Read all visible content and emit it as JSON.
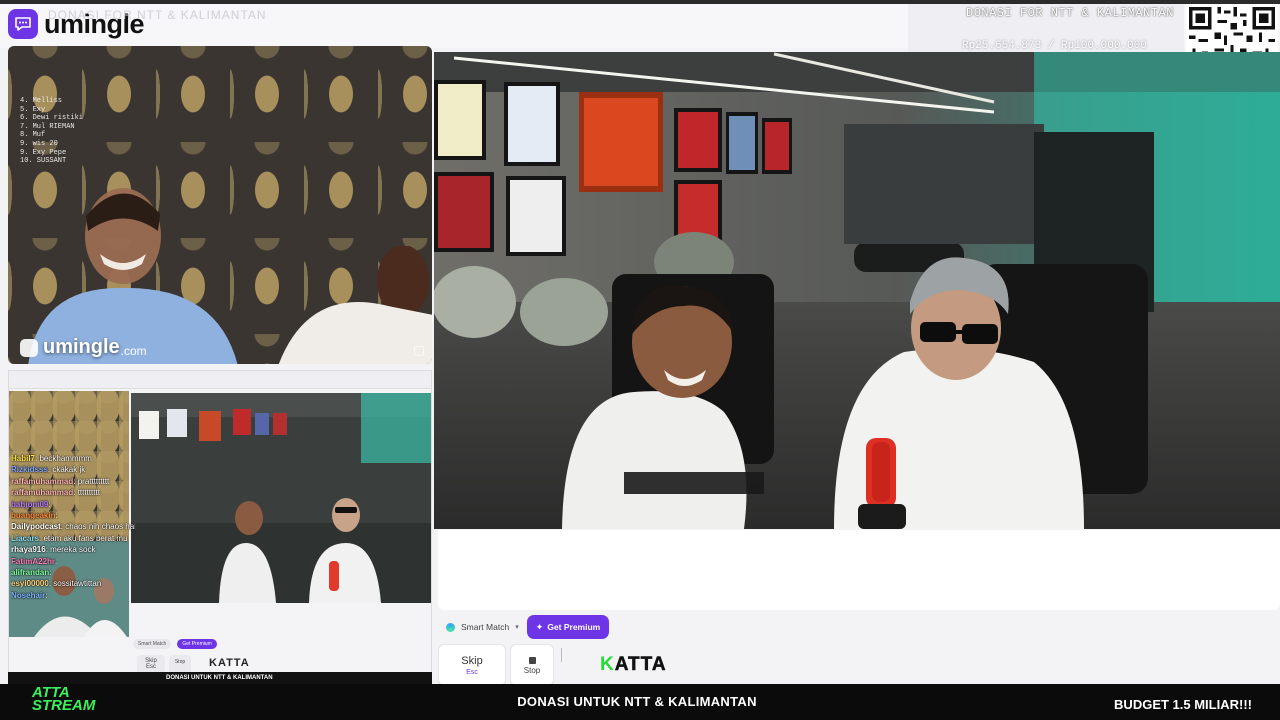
{
  "app": {
    "brand": "umingle",
    "watermark": "umingle",
    "watermark_suffix": ".com",
    "ghost_title": "DONASI FOR NTT & KALIMANTAN"
  },
  "donation": {
    "title": "DONASI FOR NTT & KALIMANTAN",
    "amount": "Rp25.654.873 / Rp100.000.000"
  },
  "leaderboard": [
    "4. Melliss",
    "5. Exy",
    "6. Dewi ristiki",
    "7. Mul RIEMAN",
    "8. Muf",
    "9. wis 20",
    "9. Exy Pepe",
    "10. SUSSANT"
  ],
  "chat": [
    {
      "user": "Habil7",
      "text": "beckhammmm",
      "color": "#ffe44d"
    },
    {
      "user": "Rizkidsss",
      "text": "ckakak jk",
      "color": "#7ea6ff"
    },
    {
      "user": "raffamuhammad",
      "text": "prattttttttt",
      "color": "#ffb3b3"
    },
    {
      "user": "raffamuhammad",
      "text": "tttttttttt",
      "color": "#ffb3b3"
    },
    {
      "user": "bahjoni09",
      "text": "",
      "color": "#b47bff"
    },
    {
      "user": "buangeakin",
      "text": "",
      "color": "#ff8a3d"
    },
    {
      "user": "Dailypodcast",
      "text": "chaos nih chaos haha",
      "color": "#ffffff"
    },
    {
      "user": "Liacars",
      "text": "etam aku fans berat mu",
      "color": "#7de3ff"
    },
    {
      "user": "rhaya916",
      "text": "mereka sock",
      "color": "#ffffff"
    },
    {
      "user": "FatimA22hr",
      "text": "",
      "color": "#ff7db8"
    },
    {
      "user": "alifrandan",
      "text": "",
      "color": "#7dff9a"
    },
    {
      "user": "esyi00000",
      "text": "sossitawtittan",
      "color": "#ffd27d"
    },
    {
      "user": "Nosehair",
      "text": "",
      "color": "#7db4ff"
    }
  ],
  "controls": {
    "smart_match": "Smart Match",
    "premium": "Get Premium",
    "skip": "Skip",
    "skip_hint": "Esc",
    "stop": "Stop",
    "katta_k": "K",
    "katta_rest": "ATTA"
  },
  "mini": {
    "smart_match": "Smart Match",
    "premium": "Get Premium",
    "skip": "Skip",
    "skip_hint": "Esc",
    "stop": "Stop",
    "katta": "KATTA",
    "banner": "DONASI UNTUK NTT & KALIMANTAN"
  },
  "footer": {
    "logo_line1": "ATTA",
    "logo_line2": "STREAM",
    "center": "DONASI UNTUK NTT & KALIMANTAN",
    "right": "BUDGET 1.5 MILIAR!!!"
  },
  "colors": {
    "accent": "#6d35e6",
    "katta_green": "#22dd33",
    "atta_green": "#3cf05a"
  }
}
